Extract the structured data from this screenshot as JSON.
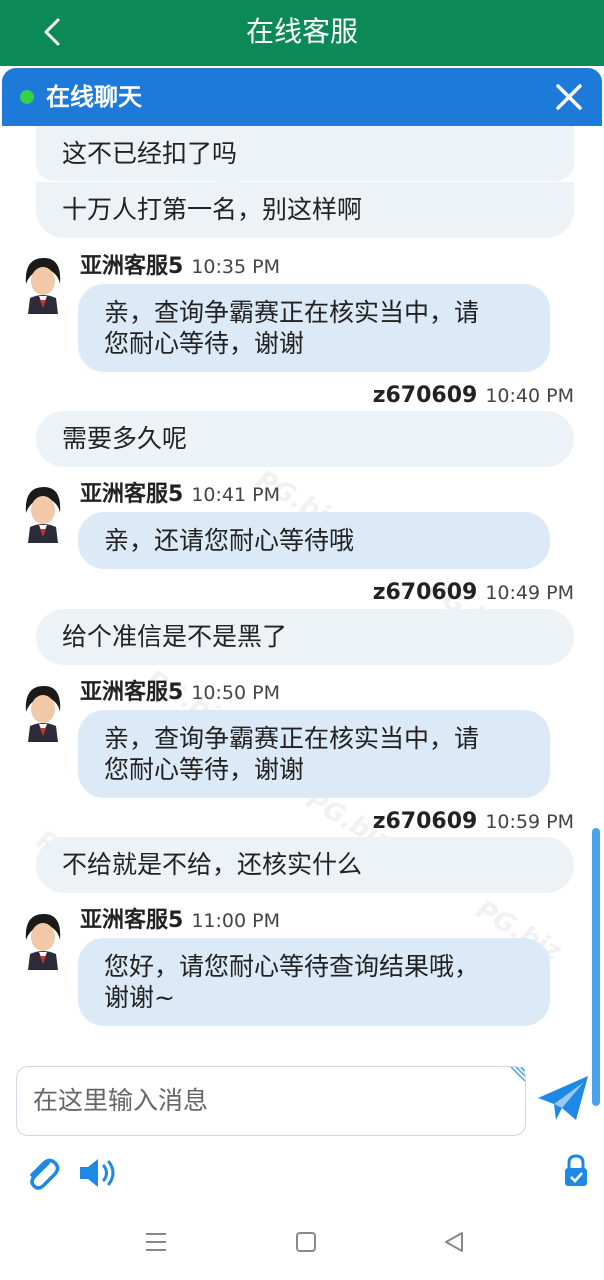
{
  "header": {
    "title": "在线客服"
  },
  "chat": {
    "title": "在线聊天",
    "status_color": "#32d34b",
    "bar_color": "#1e7ad8"
  },
  "messages": [
    {
      "from": "me",
      "text": "这不已经扣了吗"
    },
    {
      "from": "me",
      "text": "十万人打第一名，别这样啊"
    },
    {
      "from": "agent",
      "user": "亚洲客服5",
      "time": "10:35 PM",
      "lines": [
        "亲，查询争霸赛正在核实当中，请",
        "您耐心等待，谢谢"
      ]
    },
    {
      "from": "me",
      "user": "z670609",
      "time": "10:40 PM",
      "text": "需要多久呢"
    },
    {
      "from": "agent",
      "user": "亚洲客服5",
      "time": "10:41 PM",
      "lines": [
        "亲，还请您耐心等待哦"
      ]
    },
    {
      "from": "me",
      "user": "z670609",
      "time": "10:49 PM",
      "text": "给个准信是不是黑了"
    },
    {
      "from": "agent",
      "user": "亚洲客服5",
      "time": "10:50 PM",
      "lines": [
        "亲，查询争霸赛正在核实当中，请",
        "您耐心等待，谢谢"
      ]
    },
    {
      "from": "me",
      "user": "z670609",
      "time": "10:59 PM",
      "text": "不给就是不给，还核实什么"
    },
    {
      "from": "agent",
      "user": "亚洲客服5",
      "time": "11:00 PM",
      "lines": [
        "您好，请您耐心等待查询结果哦，",
        "谢谢~"
      ]
    }
  ],
  "input": {
    "placeholder": "在这里输入消息"
  },
  "icons": [
    "back-arrow-icon",
    "close-icon",
    "send-icon",
    "paperclip-icon",
    "speaker-icon",
    "lock-icon",
    "menu-icon",
    "home-icon",
    "back-triangle-icon"
  ],
  "colors": {
    "header": "#0b8a57",
    "agent_bubble": "#dceaf7",
    "me_bubble": "#edf2f7",
    "accent": "#1e88e5"
  }
}
